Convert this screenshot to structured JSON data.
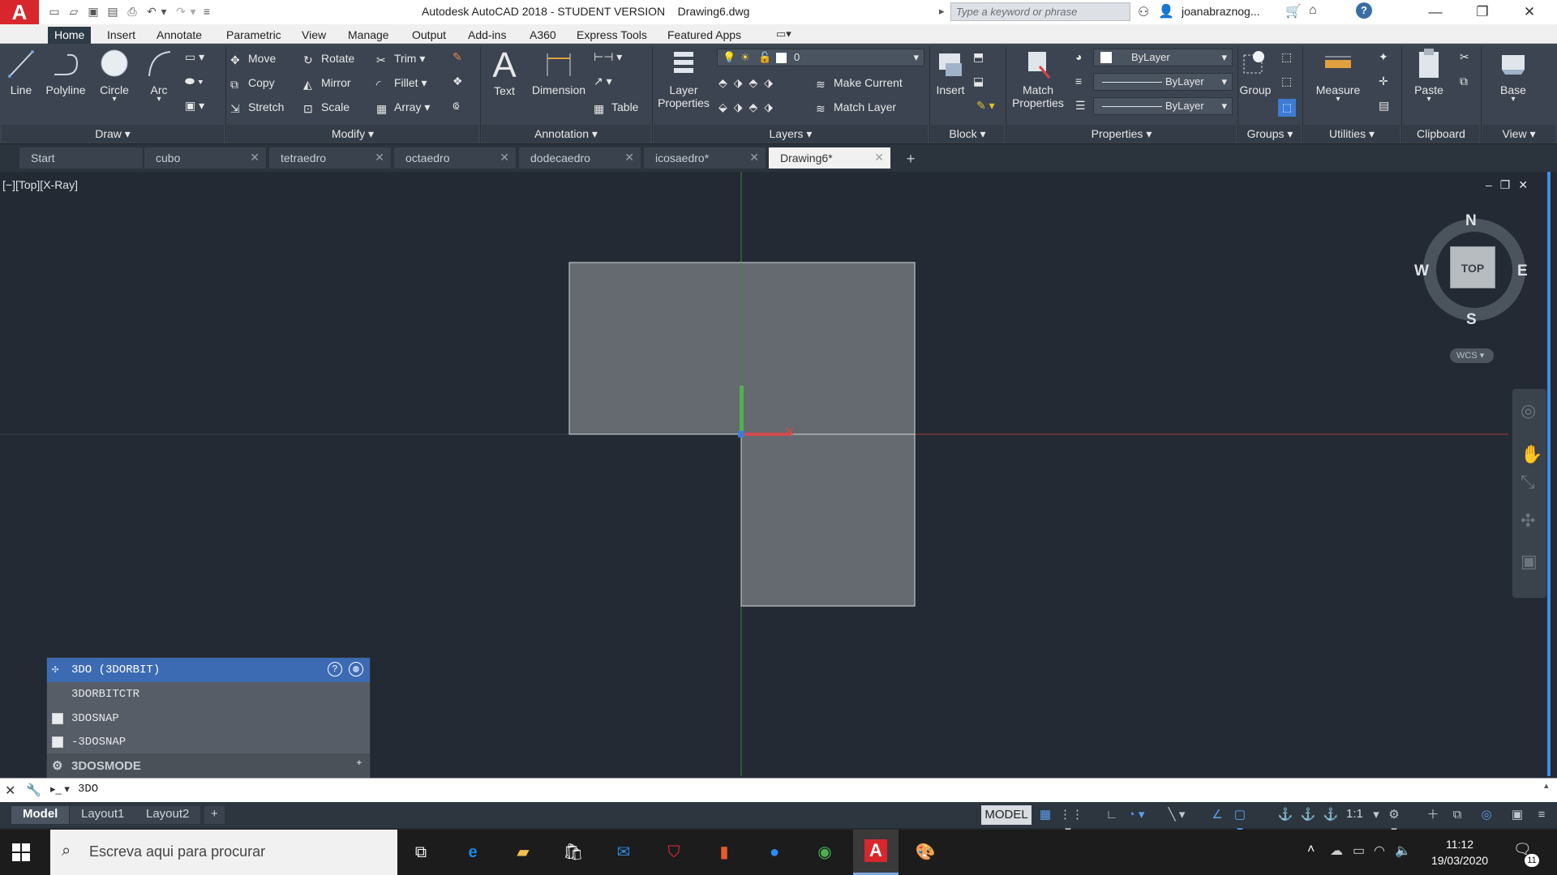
{
  "app": {
    "logo": "A",
    "title": "Autodesk AutoCAD 2018 - STUDENT VERSION    Drawing6.dwg",
    "search_placeholder": "Type a keyword or phrase",
    "user": "joanabraznog...",
    "help": "?"
  },
  "ribbon_tabs": [
    "Home",
    "Insert",
    "Annotate",
    "Parametric",
    "View",
    "Manage",
    "Output",
    "Add-ins",
    "A360",
    "Express Tools",
    "Featured Apps"
  ],
  "ribbon": {
    "draw": {
      "line": "Line",
      "polyline": "Polyline",
      "circle": "Circle",
      "arc": "Arc",
      "panel": "Draw"
    },
    "modify": {
      "move": "Move",
      "rotate": "Rotate",
      "trim": "Trim",
      "copy": "Copy",
      "mirror": "Mirror",
      "fillet": "Fillet",
      "stretch": "Stretch",
      "scale": "Scale",
      "array": "Array",
      "panel": "Modify"
    },
    "annotation": {
      "text": "Text",
      "dimension": "Dimension",
      "table": "Table",
      "panel": "Annotation"
    },
    "layers": {
      "layer_properties_1": "Layer",
      "layer_properties_2": "Properties",
      "current_layer": "0",
      "make_current": "Make Current",
      "match_layer": "Match Layer",
      "panel": "Layers"
    },
    "block": {
      "insert": "Insert",
      "panel": "Block"
    },
    "properties": {
      "match_1": "Match",
      "match_2": "Properties",
      "color": "ByLayer",
      "linetype": "ByLayer",
      "lineweight": "ByLayer",
      "panel": "Properties"
    },
    "groups": {
      "group": "Group",
      "panel": "Groups"
    },
    "utilities": {
      "measure": "Measure",
      "panel": "Utilities"
    },
    "clipboard": {
      "paste": "Paste",
      "panel": "Clipboard"
    },
    "view": {
      "base": "Base",
      "panel": "View"
    }
  },
  "doc_tabs": [
    "Start",
    "cubo",
    "tetraedro",
    "octaedro",
    "dodecaedro",
    "icosaedro*",
    "Drawing6*"
  ],
  "viewport": {
    "label": "[−][Top][X-Ray]",
    "compass": {
      "n": "N",
      "s": "S",
      "e": "E",
      "w": "W",
      "top": "TOP"
    },
    "wcs": "WCS"
  },
  "command_list": {
    "header": "3DO (3DORBIT)",
    "items": [
      "3DORBITCTR",
      "3DOSNAP",
      "-3DOSNAP"
    ],
    "footer": "3DOSMODE"
  },
  "command_line": {
    "input": "3DO"
  },
  "layout_tabs": [
    "Model",
    "Layout1",
    "Layout2"
  ],
  "status": {
    "model": "MODEL",
    "scale": "1:1"
  },
  "taskbar": {
    "search": "Escreva aqui para procurar",
    "time": "11:12",
    "date": "19/03/2020",
    "notifications": "11"
  }
}
